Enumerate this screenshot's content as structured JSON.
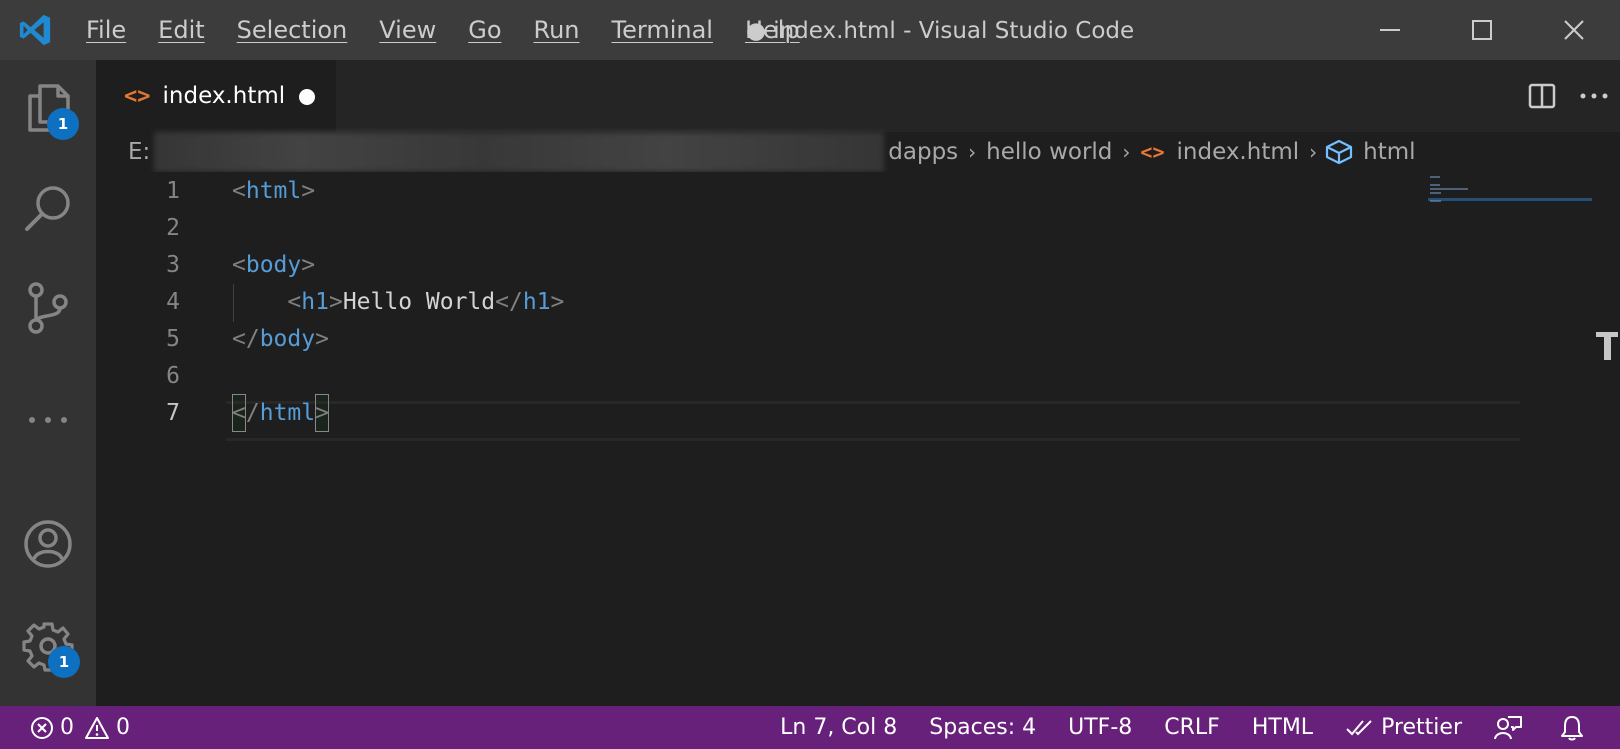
{
  "window": {
    "title": "● index.html - Visual Studio Code",
    "brand_color": "#007acc"
  },
  "menu": {
    "items": [
      {
        "label": "File"
      },
      {
        "label": "Edit"
      },
      {
        "label": "Selection"
      },
      {
        "label": "View"
      },
      {
        "label": "Go"
      },
      {
        "label": "Run"
      },
      {
        "label": "Terminal"
      },
      {
        "label": "Help"
      }
    ]
  },
  "activity_bar": {
    "explorer_badge": "1",
    "settings_badge": "1",
    "icons": [
      "files-icon",
      "search-icon",
      "source-control-icon",
      "more-icon",
      "account-icon",
      "settings-gear-icon"
    ]
  },
  "tabs": [
    {
      "label": "index.html",
      "icon": "html-code-icon",
      "dirty": true
    }
  ],
  "breadcrumb": {
    "drive": "E:",
    "items": [
      "dapps",
      "hello world",
      "index.html",
      "html"
    ]
  },
  "editor": {
    "lines": [
      {
        "number": "1",
        "tokens": [
          [
            "punc",
            "<"
          ],
          [
            "tag",
            "html"
          ],
          [
            "punc",
            ">"
          ]
        ]
      },
      {
        "number": "2",
        "tokens": []
      },
      {
        "number": "3",
        "tokens": [
          [
            "punc",
            "<"
          ],
          [
            "tag",
            "body"
          ],
          [
            "punc",
            ">"
          ]
        ]
      },
      {
        "number": "4",
        "tokens": [
          [
            "text",
            "    "
          ],
          [
            "punc",
            "<"
          ],
          [
            "tag",
            "h1"
          ],
          [
            "punc",
            ">"
          ],
          [
            "text",
            "Hello World"
          ],
          [
            "punc",
            "</"
          ],
          [
            "tag",
            "h1"
          ],
          [
            "punc",
            ">"
          ]
        ]
      },
      {
        "number": "5",
        "tokens": [
          [
            "punc",
            "</"
          ],
          [
            "tag",
            "body"
          ],
          [
            "punc",
            ">"
          ]
        ]
      },
      {
        "number": "6",
        "tokens": []
      },
      {
        "number": "7",
        "tokens": [
          [
            "punc",
            "</"
          ],
          [
            "tag",
            "html"
          ],
          [
            "punc",
            ">"
          ]
        ]
      }
    ],
    "active_line": 7,
    "colors": {
      "tag": "#569cd6",
      "punc": "#808080",
      "text": "#d4d4d4"
    }
  },
  "status_bar": {
    "errors": "0",
    "warnings": "0",
    "position": "Ln 7, Col 8",
    "spaces": "Spaces: 4",
    "encoding": "UTF-8",
    "eol": "CRLF",
    "language": "HTML",
    "formatter": "Prettier",
    "background_color": "#68217a"
  }
}
